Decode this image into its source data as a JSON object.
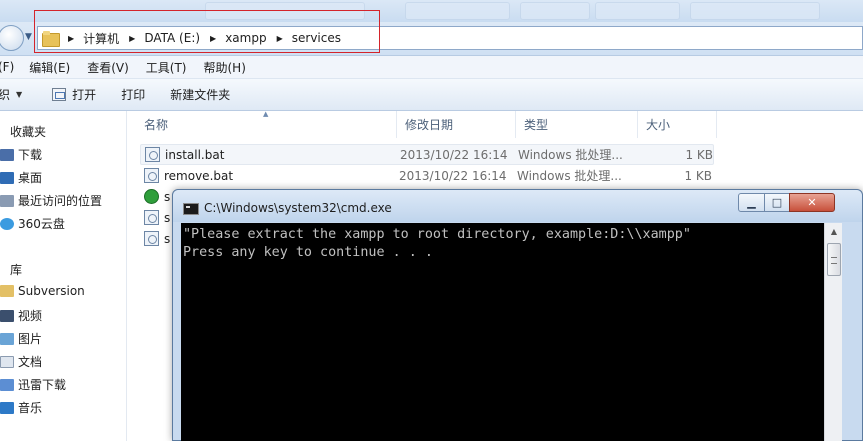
{
  "address": {
    "crumbs": [
      "计算机",
      "DATA (E:)",
      "xampp",
      "services"
    ]
  },
  "menu": [
    "(F)",
    "编辑(E)",
    "查看(V)",
    "工具(T)",
    "帮助(H)"
  ],
  "toolbar": {
    "organize_label": "织",
    "open_label": "打开",
    "print_label": "打印",
    "new_folder_label": "新建文件夹"
  },
  "sidebar": {
    "items": [
      {
        "label": "收藏夹",
        "icon": "star-icon"
      },
      {
        "label": "下载",
        "icon": "download-folder-icon"
      },
      {
        "label": "桌面",
        "icon": "desktop-icon"
      },
      {
        "label": "最近访问的位置",
        "icon": "recent-places-icon"
      },
      {
        "label": "360云盘",
        "icon": "cloud-drive-icon"
      },
      {
        "label": "库",
        "icon": "library-icon"
      },
      {
        "label": "Subversion",
        "icon": "subversion-folder-icon"
      },
      {
        "label": "视频",
        "icon": "video-library-icon"
      },
      {
        "label": "图片",
        "icon": "picture-library-icon"
      },
      {
        "label": "文档",
        "icon": "document-library-icon"
      },
      {
        "label": "迅雷下载",
        "icon": "thunder-download-icon"
      },
      {
        "label": "音乐",
        "icon": "music-library-icon"
      }
    ]
  },
  "file_list": {
    "columns": [
      "名称",
      "修改日期",
      "类型",
      "大小"
    ],
    "rows": [
      {
        "name": "install.bat",
        "date": "2013/10/22 16:14",
        "type": "Windows 批处理...",
        "size": "1 KB"
      },
      {
        "name": "remove.bat",
        "date": "2013/10/22 16:14",
        "type": "Windows 批处理...",
        "size": "1 KB"
      },
      {
        "name": "s",
        "date": "",
        "type": "",
        "size": ""
      },
      {
        "name": "s",
        "date": "",
        "type": "",
        "size": ""
      },
      {
        "name": "s",
        "date": "",
        "type": "",
        "size": ""
      }
    ]
  },
  "cmd": {
    "title": "C:\\Windows\\system32\\cmd.exe",
    "lines": [
      "\"Please extract the xampp to root directory, example:D:\\\\xampp\"",
      "Press any key to continue . . ."
    ]
  },
  "colors": {
    "highlight_box": "#d4242b",
    "console_bg": "#000000",
    "console_text": "#c0c0c0"
  }
}
